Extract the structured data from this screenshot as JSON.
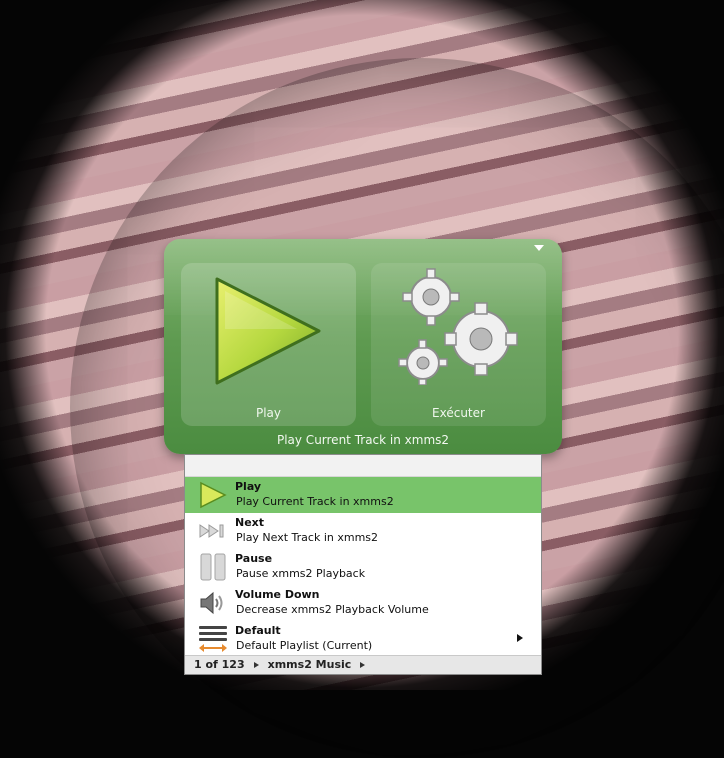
{
  "launcher": {
    "play_label": "Play",
    "run_label": "Exécuter",
    "caption": "Play Current Track in xmms2"
  },
  "results": {
    "items": [
      {
        "title": "Play",
        "subtitle": "Play Current Track in xmms2",
        "icon": "play-icon",
        "selected": true
      },
      {
        "title": "Next",
        "subtitle": "Play Next Track in xmms2",
        "icon": "next-track-icon"
      },
      {
        "title": "Pause",
        "subtitle": "Pause xmms2 Playback",
        "icon": "pause-icon"
      },
      {
        "title": "Volume Down",
        "subtitle": "Decrease xmms2 Playback Volume",
        "icon": "volume-down-icon"
      },
      {
        "title": "Default",
        "subtitle": "Default Playlist (Current)",
        "icon": "playlist-icon"
      }
    ],
    "status": {
      "position": "1 of 123",
      "source": "xmms2 Music"
    }
  },
  "colors": {
    "accent_green": "#78c46a",
    "panel_green": "#5e9a50"
  }
}
